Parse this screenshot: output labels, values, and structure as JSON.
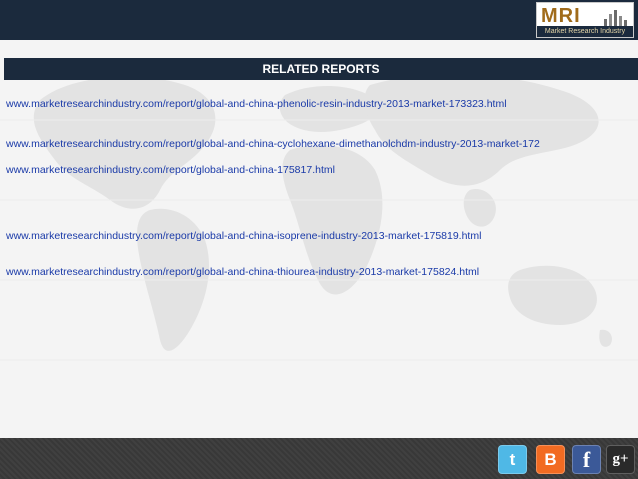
{
  "logo": {
    "mark": "MRI",
    "subtitle": "Market Research Industry"
  },
  "header": {
    "title": "RELATED REPORTS"
  },
  "reports": [
    "www.marketresearchindustry.com/report/global-and-china-phenolic-resin-industry-2013-market-173323.html",
    "www.marketresearchindustry.com/report/global-and-china-cyclohexane-dimethanolchdm-industry-2013-market-172",
    "www.marketresearchindustry.com/report/global-and-china-175817.html",
    "www.marketresearchindustry.com/report/global-and-china-isoprene-industry-2013-market-175819.html",
    "www.marketresearchindustry.com/report/global-and-china-thiourea-industry-2013-market-175824.html"
  ],
  "social": {
    "twitter": "t",
    "blogger": "B",
    "facebook": "f",
    "googleplus": "g+"
  },
  "colors": {
    "bar": "#1b2a3d",
    "link": "#1a3aa8"
  }
}
